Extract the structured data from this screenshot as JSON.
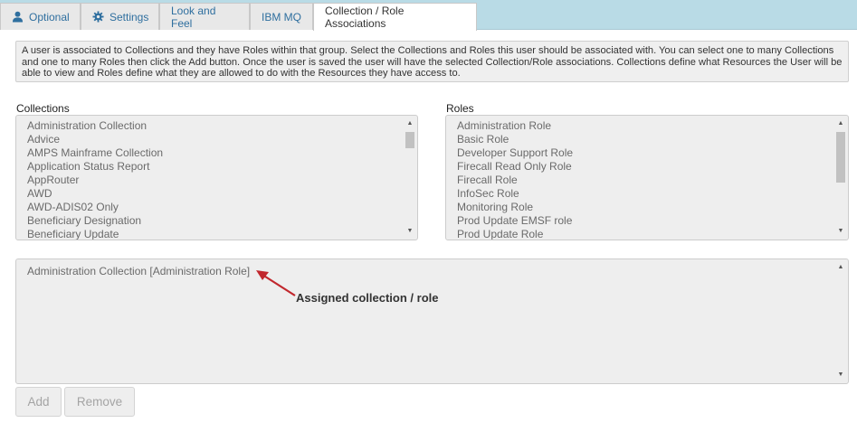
{
  "tabs": [
    {
      "label": "Optional",
      "icon": "user-icon"
    },
    {
      "label": "Settings",
      "icon": "gear-icon"
    },
    {
      "label": "Look and Feel"
    },
    {
      "label": "IBM MQ"
    },
    {
      "label": "Collection / Role Associations",
      "active": true
    }
  ],
  "help_text": "A user is associated to Collections and they have Roles within that group. Select the Collections and Roles this user should be associated with. You can select one to many Collections and one to many Roles then click the Add button. Once the user is saved the user will have the selected Collection/Role associations. Collections define what Resources the User will be able to view and Roles define what they are allowed to do with the Resources they have access to.",
  "collections": {
    "label": "Collections",
    "items": [
      "Administration Collection",
      "Advice",
      "AMPS Mainframe Collection",
      "Application Status Report",
      "AppRouter",
      "AWD",
      "AWD-ADIS02 Only",
      "Beneficiary Designation",
      "Beneficiary Update"
    ]
  },
  "roles": {
    "label": "Roles",
    "items": [
      "Administration Role",
      "Basic Role",
      "Developer Support Role",
      "Firecall Read Only Role",
      "Firecall Role",
      "InfoSec Role",
      "Monitoring Role",
      "Prod Update EMSF role",
      "Prod Update Role"
    ]
  },
  "assigned": {
    "items": [
      "Administration Collection [Administration Role]"
    ],
    "annotation": "Assigned collection / role"
  },
  "buttons": {
    "add": "Add",
    "remove": "Remove"
  },
  "colors": {
    "tab_bar": "#b9dbe6",
    "tab_link": "#2f6f9f",
    "annotation_arrow": "#c1272d"
  }
}
